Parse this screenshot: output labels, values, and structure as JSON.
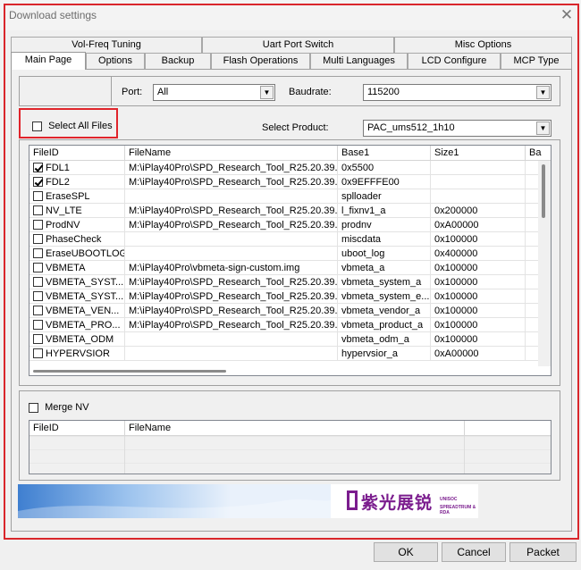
{
  "window": {
    "title": "Download settings",
    "close_glyph": "✕"
  },
  "tabs_back": [
    "Vol-Freq Tuning",
    "Uart Port Switch",
    "Misc Options"
  ],
  "tabs_front": [
    "Main Page",
    "Options",
    "Backup",
    "Flash Operations",
    "Multi Languages",
    "LCD Configure",
    "MCP Type"
  ],
  "active_tab": "Main Page",
  "port": {
    "label": "Port:",
    "value": "All"
  },
  "baudrate": {
    "label": "Baudrate:",
    "value": "115200"
  },
  "select_all": {
    "label": "Select All Files",
    "checked": false
  },
  "product": {
    "label": "Select Product:",
    "value": "PAC_ums512_1h10"
  },
  "file_table": {
    "columns": [
      "FileID",
      "FileName",
      "Base1",
      "Size1",
      "Ba"
    ],
    "rows": [
      {
        "id": "FDL1",
        "checked": true,
        "file": "M:\\iPlay40Pro\\SPD_Research_Tool_R25.20.39...",
        "base": "0x5500",
        "size": ""
      },
      {
        "id": "FDL2",
        "checked": true,
        "file": "M:\\iPlay40Pro\\SPD_Research_Tool_R25.20.39...",
        "base": "0x9EFFFE00",
        "size": ""
      },
      {
        "id": "EraseSPL",
        "checked": false,
        "file": "",
        "base": "splloader",
        "size": ""
      },
      {
        "id": "NV_LTE",
        "checked": false,
        "file": "M:\\iPlay40Pro\\SPD_Research_Tool_R25.20.39...",
        "base": "l_fixnv1_a",
        "size": "0x200000"
      },
      {
        "id": "ProdNV",
        "checked": false,
        "file": "M:\\iPlay40Pro\\SPD_Research_Tool_R25.20.39...",
        "base": "prodnv",
        "size": "0xA00000"
      },
      {
        "id": "PhaseCheck",
        "checked": false,
        "file": "",
        "base": "miscdata",
        "size": "0x100000"
      },
      {
        "id": "EraseUBOOTLOG",
        "checked": false,
        "file": "",
        "base": "uboot_log",
        "size": "0x400000"
      },
      {
        "id": "VBMETA",
        "checked": false,
        "file": "M:\\iPlay40Pro\\vbmeta-sign-custom.img",
        "base": "vbmeta_a",
        "size": "0x100000"
      },
      {
        "id": "VBMETA_SYST...",
        "checked": false,
        "file": "M:\\iPlay40Pro\\SPD_Research_Tool_R25.20.39...",
        "base": "vbmeta_system_a",
        "size": "0x100000"
      },
      {
        "id": "VBMETA_SYST...",
        "checked": false,
        "file": "M:\\iPlay40Pro\\SPD_Research_Tool_R25.20.39...",
        "base": "vbmeta_system_e...",
        "size": "0x100000"
      },
      {
        "id": "VBMETA_VEN...",
        "checked": false,
        "file": "M:\\iPlay40Pro\\SPD_Research_Tool_R25.20.39...",
        "base": "vbmeta_vendor_a",
        "size": "0x100000"
      },
      {
        "id": "VBMETA_PRO...",
        "checked": false,
        "file": "M:\\iPlay40Pro\\SPD_Research_Tool_R25.20.39...",
        "base": "vbmeta_product_a",
        "size": "0x100000"
      },
      {
        "id": "VBMETA_ODM",
        "checked": false,
        "file": "",
        "base": "vbmeta_odm_a",
        "size": "0x100000"
      },
      {
        "id": "HYPERVSIOR",
        "checked": false,
        "file": "",
        "base": "hypervsior_a",
        "size": "0xA00000"
      }
    ]
  },
  "merge_nv": {
    "label": "Merge NV",
    "checked": false
  },
  "nv_table": {
    "columns": [
      "FileID",
      "FileName"
    ]
  },
  "banner": {
    "logo_text": "紫光展锐",
    "sub_text_1": "UNISOC",
    "sub_text_2": "SPREADTRUM & RDA"
  },
  "buttons": {
    "ok": "OK",
    "cancel": "Cancel",
    "packet": "Packet"
  },
  "colors": {
    "highlight_red": "#e0242b",
    "logo_purple": "#7b1d8e",
    "banner_blue": "#3f7fd0"
  }
}
